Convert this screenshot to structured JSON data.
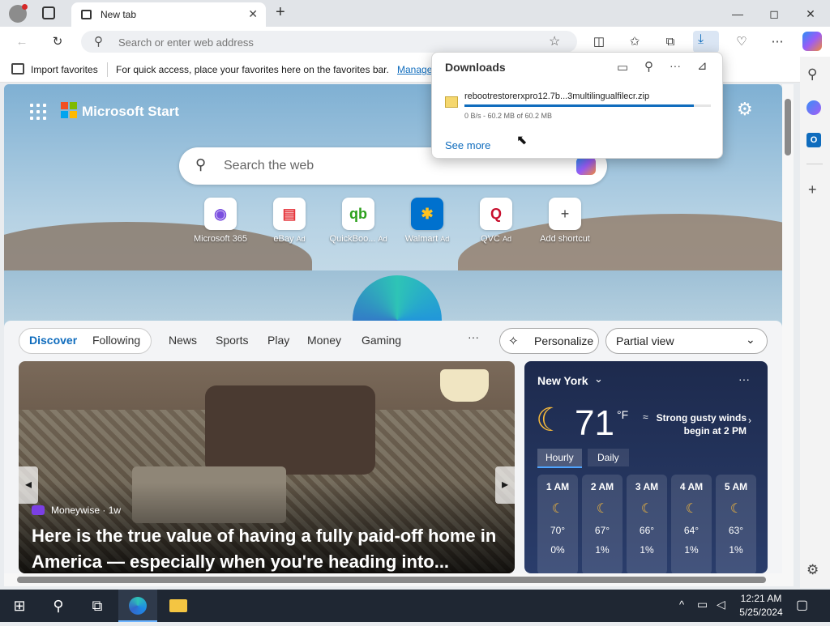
{
  "tab": {
    "title": "New tab",
    "close": "✕",
    "new": "+"
  },
  "window": {
    "minimize": "—",
    "maximize": "◻",
    "close": "✕"
  },
  "address": {
    "placeholder": "Search or enter web address"
  },
  "favorites_bar": {
    "import_label": "Import favorites",
    "message": "For quick access, place your favorites here on the favorites bar.",
    "manage_link": "Manage"
  },
  "downloads": {
    "title": "Downloads",
    "filename": "rebootrestorerxpro12.7b...3multilingualfilecr.zip",
    "status": "0 B/s - 60.2 MB of 60.2 MB",
    "progress": 0.93,
    "see_more": "See more"
  },
  "start": {
    "brand": "Microsoft Start",
    "search_placeholder": "Search the web"
  },
  "quick_links": [
    {
      "label": "Microsoft 365",
      "icon": "m365-icon",
      "ad": ""
    },
    {
      "label": "eBay",
      "icon": "ebay-icon",
      "ad": "Ad"
    },
    {
      "label": "QuickBoo...",
      "icon": "quickbooks-icon",
      "ad": "Ad"
    },
    {
      "label": "Walmart",
      "icon": "walmart-icon",
      "ad": "Ad"
    },
    {
      "label": "QVC",
      "icon": "qvc-icon",
      "ad": "Ad"
    },
    {
      "label": "Add shortcut",
      "icon": "plus-icon",
      "ad": ""
    }
  ],
  "feed": {
    "tabs": [
      "Discover",
      "Following",
      "News",
      "Sports",
      "Play",
      "Money",
      "Gaming"
    ],
    "more": "···",
    "personalize": "Personalize",
    "view": "Partial view"
  },
  "article": {
    "source": "Moneywise · 1w",
    "headline": "Here is the true value of having a fully paid-off home in America — especially when you're heading into..."
  },
  "weather": {
    "location": "New York",
    "temp": "71",
    "unit": "°F",
    "alert": "Strong gusty winds begin at 2 PM",
    "tab_hourly": "Hourly",
    "tab_daily": "Daily",
    "hours": [
      {
        "time": "1 AM",
        "temp": "70°",
        "precip": "0%"
      },
      {
        "time": "2 AM",
        "temp": "67°",
        "precip": "1%"
      },
      {
        "time": "3 AM",
        "temp": "66°",
        "precip": "1%"
      },
      {
        "time": "4 AM",
        "temp": "64°",
        "precip": "1%"
      },
      {
        "time": "5 AM",
        "temp": "63°",
        "precip": "1%"
      }
    ]
  },
  "taskbar": {
    "time": "12:21 AM",
    "date": "5/25/2024"
  },
  "colors": {
    "accent": "#1a73e8",
    "progress": "#0f6cbd",
    "taskbar": "#1f2733"
  }
}
